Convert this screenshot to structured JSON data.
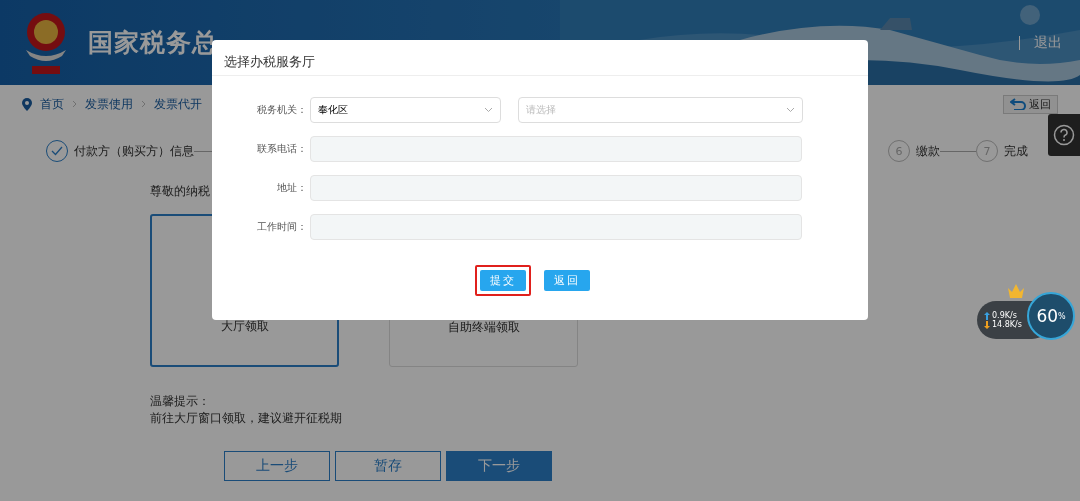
{
  "header": {
    "title": "国家税务总",
    "logout": "退出"
  },
  "breadcrumb": [
    "首页",
    "发票使用",
    "发票代开"
  ],
  "return_button": "返回",
  "steps": [
    {
      "kind": "done",
      "label": "付款方（购买方）信息"
    },
    {
      "kind": "pending",
      "number": "6",
      "label": "缴款"
    },
    {
      "kind": "pending",
      "number": "7",
      "label": "完成"
    }
  ],
  "greeting": "尊敬的纳税",
  "options": [
    {
      "label": "大厅领取",
      "selected": true
    },
    {
      "label": "自助终端领取",
      "selected": false
    }
  ],
  "tip": {
    "title": "温馨提示：",
    "text": "前往大厅窗口领取，建议避开征税期"
  },
  "footer_buttons": [
    {
      "label": "上一步",
      "kind": "outline"
    },
    {
      "label": "暂存",
      "kind": "outline"
    },
    {
      "label": "下一步",
      "kind": "primary"
    }
  ],
  "dialog": {
    "title": "选择办税服务厅",
    "fields": [
      {
        "kind": "selects",
        "label": "税务机关：",
        "value": "奉化区",
        "placeholder": "请选择"
      },
      {
        "kind": "input",
        "label": "联系电话："
      },
      {
        "kind": "input",
        "label": "地址："
      },
      {
        "kind": "input",
        "label": "工作时间："
      }
    ],
    "buttons": [
      {
        "label": "提交",
        "highlighted": true
      },
      {
        "label": "返回",
        "highlighted": false
      }
    ]
  },
  "network_widget": {
    "upload": "0.9K/s",
    "download": "14.8K/s",
    "percent": "60",
    "unit": "%"
  }
}
